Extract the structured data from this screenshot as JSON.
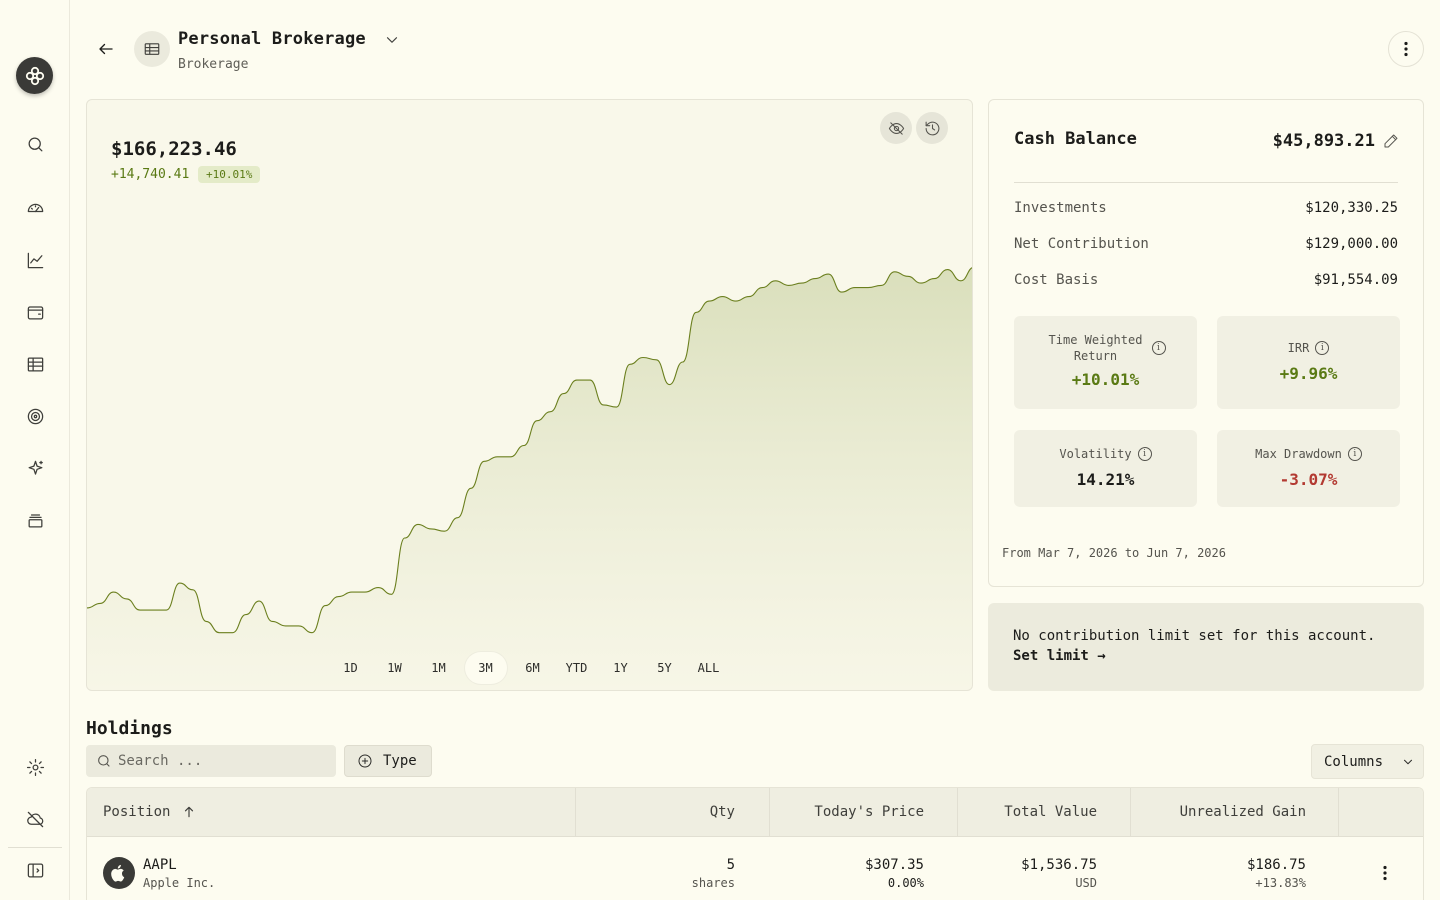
{
  "sidebar": {
    "items": [
      {
        "icon": "search-icon"
      },
      {
        "icon": "dashboard-gauge-icon"
      },
      {
        "icon": "chart-line-icon"
      },
      {
        "icon": "wallet-icon"
      },
      {
        "icon": "ledger-icon"
      },
      {
        "icon": "target-icon"
      },
      {
        "icon": "sparkle-icon"
      },
      {
        "icon": "stack-icon"
      }
    ],
    "bottom": [
      {
        "icon": "settings-gear-icon"
      },
      {
        "icon": "cloud-off-icon"
      },
      {
        "icon": "sidebar-toggle-icon"
      }
    ]
  },
  "header": {
    "account_name": "Personal Brokerage",
    "account_type": "Brokerage"
  },
  "chart_card": {
    "balance": "$166,223.46",
    "change": "+14,740.41",
    "change_pct": "+10.01%",
    "ranges": [
      "1D",
      "1W",
      "1M",
      "3M",
      "6M",
      "YTD",
      "1Y",
      "5Y",
      "ALL"
    ],
    "active_range": "3M"
  },
  "chart_data": {
    "type": "area",
    "title": "",
    "xlabel": "",
    "ylabel": "",
    "series": [
      {
        "values": [
          152.1,
          152.3,
          152.8,
          152.5,
          152.0,
          152.0,
          152.0,
          153.2,
          152.9,
          151.5,
          151.0,
          151.0,
          151.8,
          152.4,
          151.5,
          151.3,
          151.3,
          151.0,
          152.2,
          152.6,
          152.8,
          152.8,
          153.0,
          152.7,
          155.2,
          155.8,
          155.6,
          155.5,
          156.1,
          157.4,
          158.6,
          158.8,
          158.8,
          159.3,
          160.4,
          160.8,
          161.6,
          162.2,
          162.2,
          161.1,
          161.0,
          162.9,
          163.2,
          163.1,
          162.0,
          163.0,
          165.2,
          165.7,
          165.9,
          165.7,
          165.9,
          166.3,
          166.6,
          166.4,
          166.5,
          166.7,
          166.9,
          166.1,
          166.3,
          166.3,
          166.4,
          167.0,
          166.8,
          166.5,
          166.7,
          167.1,
          166.6,
          167.2
        ]
      }
    ]
  },
  "summary": {
    "cash_label": "Cash Balance",
    "cash_value": "$45,893.21",
    "rows": [
      {
        "label": "Investments",
        "value": "$120,330.25"
      },
      {
        "label": "Net Contribution",
        "value": "$129,000.00"
      },
      {
        "label": "Cost Basis",
        "value": "$91,554.09"
      }
    ],
    "metrics": [
      {
        "label": "Time Weighted Return",
        "value": "+10.01%"
      },
      {
        "label": "IRR",
        "value": "+9.96%"
      },
      {
        "label": "Volatility",
        "value": "14.21%"
      },
      {
        "label": "Max Drawdown",
        "value": "-3.07%"
      }
    ],
    "date_range": "From Mar 7, 2026 to Jun 7, 2026"
  },
  "contribution": {
    "text": "No contribution limit set for this account.",
    "link": "Set limit →"
  },
  "holdings": {
    "title": "Holdings",
    "search_placeholder": "Search ...",
    "type_label": "Type",
    "columns_label": "Columns",
    "headers": {
      "position": "Position",
      "qty": "Qty",
      "price": "Today's Price",
      "total": "Total Value",
      "gain": "Unrealized Gain"
    },
    "rows": [
      {
        "ticker": "AAPL",
        "name": "Apple Inc.",
        "qty": "5",
        "qty_unit": "shares",
        "price": "$307.35",
        "price_change": "0.00%",
        "total": "$1,536.75",
        "currency": "USD",
        "gain": "$186.75",
        "gain_pct": "+13.83%"
      }
    ]
  },
  "colors": {
    "background": "#fdfcf0",
    "accent_green": "#5a7a14",
    "negative_red": "#b33a32",
    "chart_line": "#6b7f1e"
  }
}
